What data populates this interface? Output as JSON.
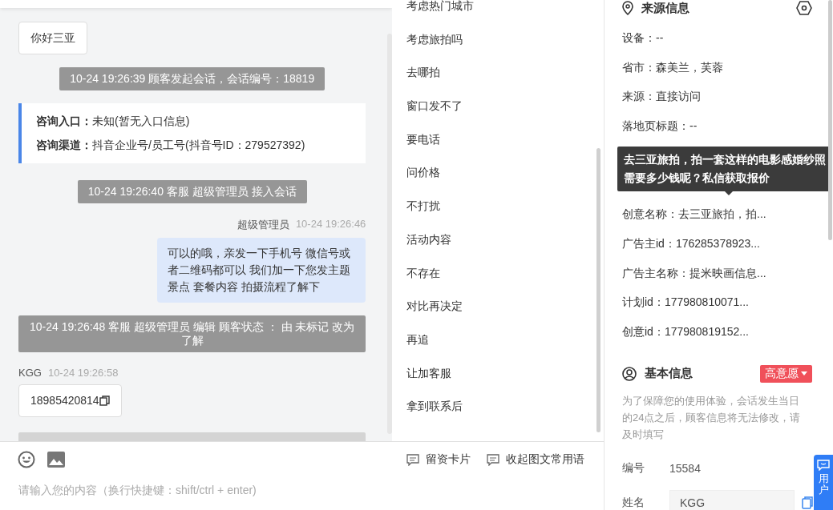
{
  "chat": {
    "messages": [
      {
        "kind": "incoming",
        "text": "你好三亚"
      },
      {
        "kind": "system",
        "text": "10-24 19:26:39 顾客发起会话，会话编号：18819"
      },
      {
        "kind": "info",
        "fields": [
          {
            "label": "咨询入口：",
            "value": "未知(暂无入口信息)"
          },
          {
            "label": "咨询渠道：",
            "value": "抖音企业号/员工号(抖音号ID：279527392)"
          }
        ]
      },
      {
        "kind": "system",
        "text": "10-24 19:26:40 客服 超级管理员 接入会话"
      },
      {
        "kind": "outgoing",
        "sender": "超级管理员",
        "time": "10-24 19:26:46",
        "text": "可以的哦，亲发一下手机号 微信号或者二维码都可以 我们加一下您发主题景点 套餐内容 拍摄流程了解下"
      },
      {
        "kind": "system",
        "text": "10-24 19:26:48 客服 超级管理员 编辑 顾客状态 ： 由 未标记 改为了解"
      },
      {
        "kind": "incoming",
        "sender": "KGG",
        "time": "10-24 19:26:58",
        "text": "18985420814",
        "copyable": true
      }
    ]
  },
  "quick_phrases": [
    "考虑热门城市",
    "考虑旅拍吗",
    "去哪拍",
    "窗口发不了",
    "要电话",
    "问价格",
    "不打扰",
    "活动内容",
    "不存在",
    "对比再决定",
    "再追",
    "让加客服",
    "拿到联系后"
  ],
  "composer": {
    "tools": [
      {
        "label": "留资卡片"
      },
      {
        "label": "收起图文常用语"
      }
    ],
    "placeholder": "请输入您的内容（换行快捷键：shift/ctrl + enter)"
  },
  "source_info": {
    "title": "来源信息",
    "rows": [
      {
        "text": "设备：--"
      },
      {
        "text": "省市：森美兰，芙蓉"
      },
      {
        "text": "来源：直接访问"
      },
      {
        "text": "落地页标题：--"
      }
    ],
    "rows_below_tooltip": [
      {
        "text": "创意名称：去三亚旅拍，拍..."
      },
      {
        "text": "广告主id：176285378923..."
      },
      {
        "text": "广告主名称：提米映画信息..."
      },
      {
        "text": "计划id：177980810071..."
      },
      {
        "text": "创意id：177980819152..."
      }
    ],
    "tooltip": "去三亚旅拍，拍一套这样的电影感婚纱照需要多少钱呢？私信获取报价"
  },
  "basic_info": {
    "title": "基本信息",
    "intent": "高意愿",
    "note": "为了保障您的使用体验，会话发生当日的24点之后，顾客信息将无法修改，请及时填写",
    "fields": [
      {
        "kind": "text",
        "label": "编号",
        "value": "15584"
      },
      {
        "kind": "input",
        "label": "姓名",
        "value": "KGG"
      }
    ]
  },
  "floating_tab": {
    "label": "用户"
  }
}
